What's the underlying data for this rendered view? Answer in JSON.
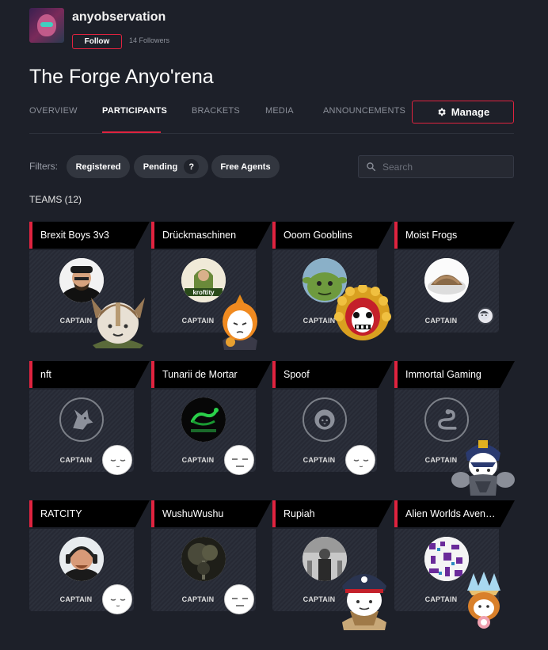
{
  "org": {
    "name": "anyobservation",
    "follow_label": "Follow",
    "followers": "14 Followers"
  },
  "page_title": "The Forge Anyo'rena",
  "tabs": [
    {
      "label": "OVERVIEW"
    },
    {
      "label": "PARTICIPANTS",
      "active": true
    },
    {
      "label": "BRACKETS"
    },
    {
      "label": "MEDIA"
    },
    {
      "label": "ANNOUNCEMENTS"
    }
  ],
  "manage_label": "Manage",
  "filters": {
    "label": "Filters:",
    "chips": [
      "Registered",
      "Pending",
      "Free Agents"
    ],
    "pending_help": "?"
  },
  "search": {
    "placeholder": "Search",
    "icon": "search-icon"
  },
  "teams_heading": "TEAMS (12)",
  "captain_label": "CAPTAIN",
  "teams": [
    {
      "name": "Brexit Boys 3v3",
      "avatar": "photo-man",
      "captain": "viking-helmet-avatar"
    },
    {
      "name": "Drückmaschinen",
      "avatar": "poster-logo",
      "captain": "hooded-knight-avatar"
    },
    {
      "name": "Ooom Gooblins",
      "avatar": "goblin-photo",
      "captain": "red-lion-mask-avatar"
    },
    {
      "name": "Moist Frogs",
      "avatar": "food-photo",
      "captain": "small-face-avatar"
    },
    {
      "name": "nft",
      "avatar": "default-wolf-icon",
      "captain": "sleepy-face-avatar"
    },
    {
      "name": "Tunarii de Mortar",
      "avatar": "green-snake-logo",
      "captain": "meh-face-avatar"
    },
    {
      "name": "Spoof",
      "avatar": "default-lion-icon",
      "captain": "sleepy-face-avatar"
    },
    {
      "name": "Immortal Gaming",
      "avatar": "default-snake-icon",
      "captain": "armored-knight-avatar"
    },
    {
      "name": "RATCITY",
      "avatar": "photo-man-headset",
      "captain": "sleepy-face-avatar"
    },
    {
      "name": "WushuWushu",
      "avatar": "forest-photo",
      "captain": "meh-face-avatar"
    },
    {
      "name": "Rupiah",
      "avatar": "bw-photo",
      "captain": "pirate-avatar"
    },
    {
      "name": "Alien Worlds Avengers",
      "avatar": "qr-pixel-art",
      "captain": "crystal-hair-avatar"
    }
  ],
  "colors": {
    "accent": "#e0233f",
    "background": "#1d2029",
    "card": "#2a2d37"
  }
}
